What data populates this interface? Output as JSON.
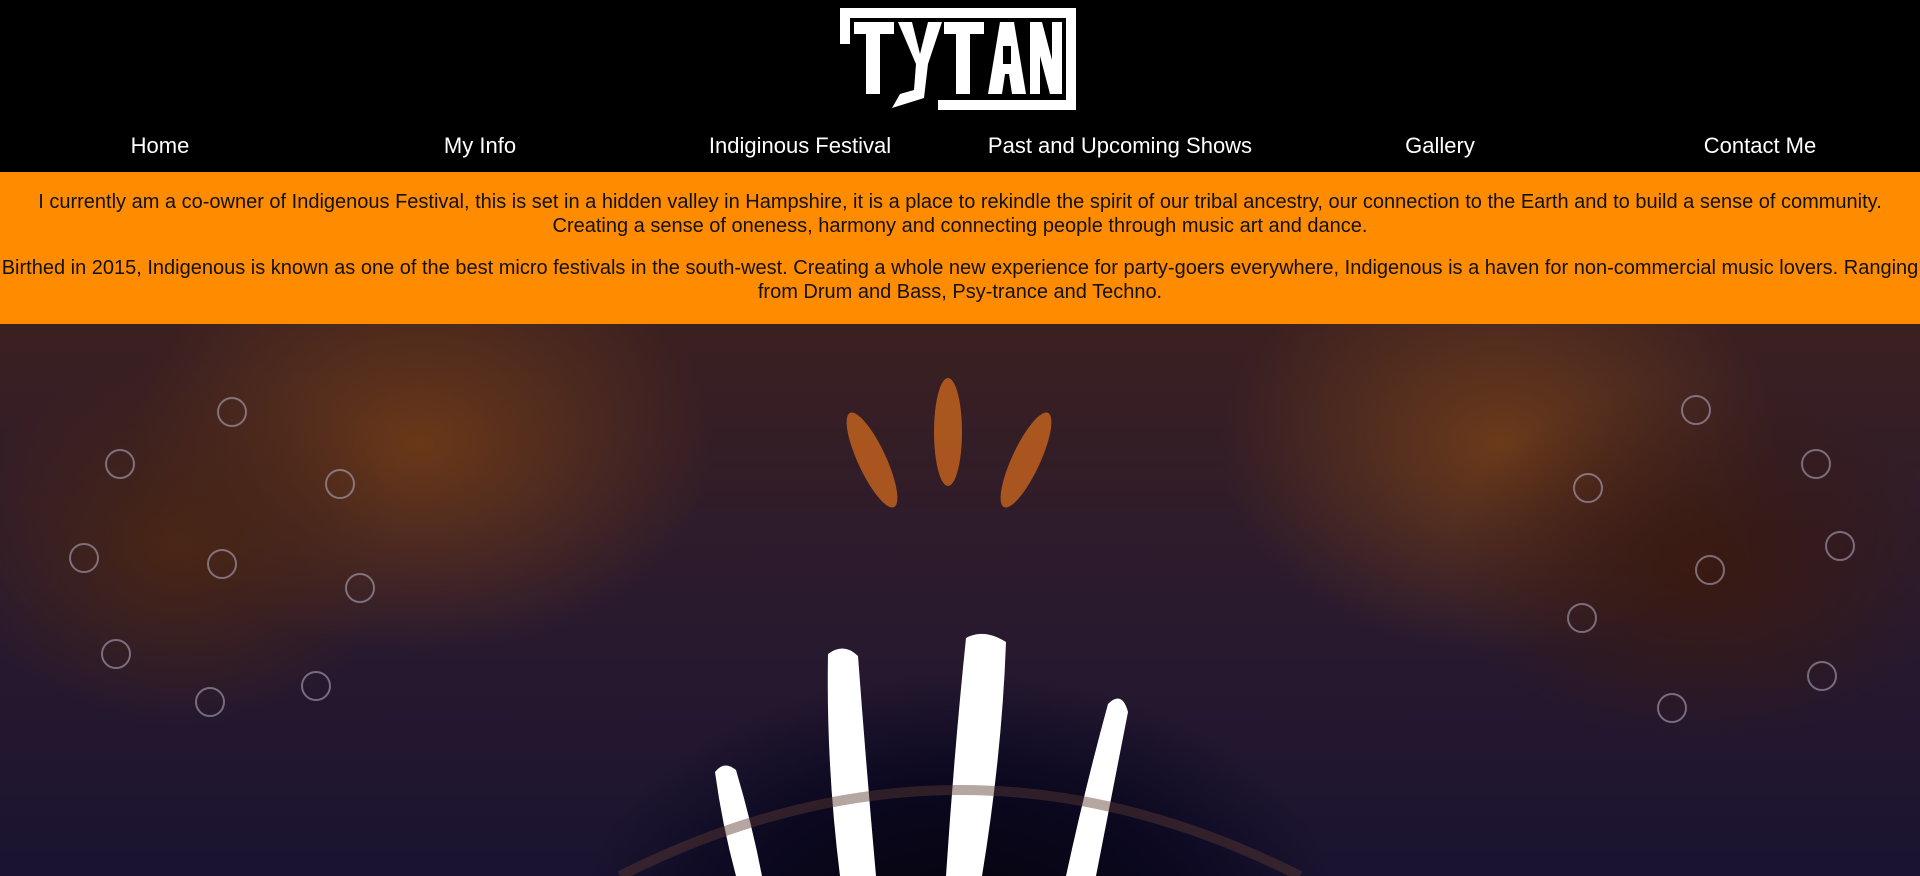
{
  "header": {
    "logo_text": "TYTAN"
  },
  "nav": {
    "items": [
      {
        "label": "Home"
      },
      {
        "label": "My Info"
      },
      {
        "label": "Indiginous Festival"
      },
      {
        "label": "Past and Upcoming Shows"
      },
      {
        "label": "Gallery"
      },
      {
        "label": "Contact Me"
      }
    ]
  },
  "info": {
    "paragraph_1": "I currently am a co-owner of Indigenous Festival, this is set in a hidden valley in Hampshire, it is a place to rekindle the spirit of our tribal ancestry, our connection to the Earth and to build a sense of community. Creating a sense of oneness, harmony and connecting people through music art and dance.",
    "paragraph_2": "Birthed in 2015, Indigenous is known as one of the best micro festivals in the south-west. Creating a whole new experience for party-goers everywhere, Indigenous is a haven for non-commercial music lovers. Ranging from Drum and Bass, Psy-trance and Techno."
  },
  "hero": {
    "image": "indigenous-festival-hand-artwork"
  },
  "colors": {
    "header_bg": "#000000",
    "nav_text": "#ffffff",
    "info_bg": "#ff8c00",
    "info_text": "#111111"
  }
}
